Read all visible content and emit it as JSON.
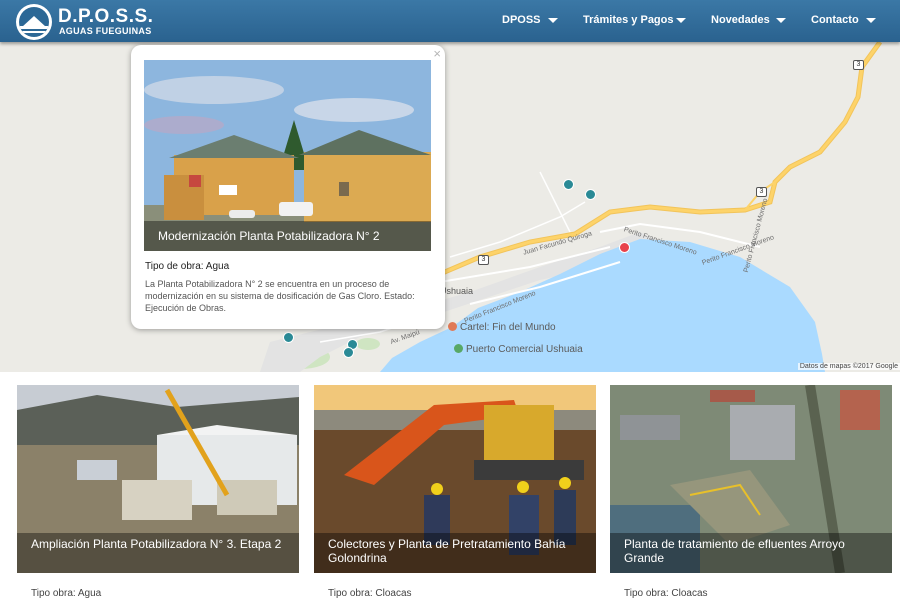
{
  "header": {
    "brand": "D.P.O.S.S.",
    "brand_sub": "AGUAS FUEGUINAS",
    "nav": [
      "DPOSS",
      "Trámites y Pagos",
      "Novedades",
      "Contacto"
    ]
  },
  "map": {
    "labels": {
      "juan_facundo_quiroga": "Juan Facundo Quiroga",
      "perito_moreno_1": "Perito Francisco Moreno",
      "perito_moreno_2": "Perito Francisco Moreno",
      "perito_moreno_3": "Perito Francisco Moreno",
      "perito_moreno_4": "Perito Francisco Moreno",
      "av_maipu": "Av. Maipú",
      "ushuaia": "Ushuaia",
      "route_3": "3"
    },
    "pois": {
      "cartel": "Cartel: Fin del Mundo",
      "puerto": "Puerto Comercial Ushuaia"
    },
    "credits": "Datos de mapas ©2017 Google",
    "colors": {
      "water": "#aadaff",
      "land": "#ecebe6",
      "highway": "#fdd36a",
      "marker_agua": "#2a8a96",
      "marker_selected": "#e8414a"
    }
  },
  "popup": {
    "close": "×",
    "title": "Modernización Planta Potabilizadora N° 2",
    "type": "Tipo de obra: Agua",
    "description": "La Planta Potabilizadora N° 2 se encuentra en un proceso de modernización en su sistema de dosificación de Gas Cloro. Estado: Ejecución de Obras."
  },
  "cards": [
    {
      "title": "Ampliación Planta Potabilizadora N° 3. Etapa 2",
      "type": "Tipo obra: Agua"
    },
    {
      "title": "Colectores y Planta de Pretratamiento Bahía Golondrina",
      "type": "Tipo obra: Cloacas"
    },
    {
      "title": "Planta de tratamiento de efluentes Arroyo Grande",
      "type": "Tipo obra: Cloacas"
    }
  ]
}
